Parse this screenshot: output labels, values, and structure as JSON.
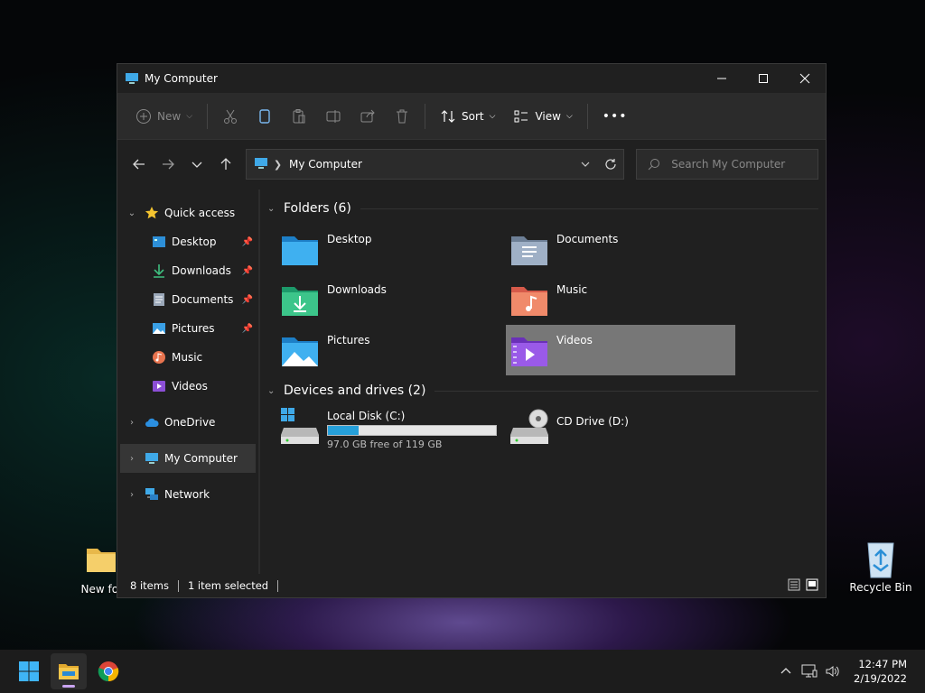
{
  "desktop": {
    "new_folder_label": "New fol",
    "recycle_bin_label": "Recycle Bin"
  },
  "window": {
    "title": "My Computer",
    "controls": {
      "minimize": "minimize",
      "maximize": "maximize",
      "close": "close"
    }
  },
  "toolbar": {
    "new_label": "New",
    "sort_label": "Sort",
    "view_label": "View",
    "more_label": "•••"
  },
  "navbar": {
    "address_text": "My Computer",
    "search_placeholder": "Search My Computer"
  },
  "sidebar": {
    "quick_access": "Quick access",
    "items": [
      {
        "label": "Desktop",
        "pinned": true
      },
      {
        "label": "Downloads",
        "pinned": true
      },
      {
        "label": "Documents",
        "pinned": true
      },
      {
        "label": "Pictures",
        "pinned": true
      },
      {
        "label": "Music",
        "pinned": false
      },
      {
        "label": "Videos",
        "pinned": false
      }
    ],
    "onedrive": "OneDrive",
    "my_computer": "My Computer",
    "network": "Network"
  },
  "main": {
    "folders_header": "Folders (6)",
    "folders": [
      {
        "name": "Desktop",
        "icon": "desktop-folder-icon"
      },
      {
        "name": "Documents",
        "icon": "documents-folder-icon"
      },
      {
        "name": "Downloads",
        "icon": "downloads-folder-icon"
      },
      {
        "name": "Music",
        "icon": "music-folder-icon"
      },
      {
        "name": "Pictures",
        "icon": "pictures-folder-icon"
      },
      {
        "name": "Videos",
        "icon": "videos-folder-icon",
        "selected": true
      }
    ],
    "devices_header": "Devices and drives (2)",
    "drives": [
      {
        "name": "Local Disk (C:)",
        "free_text": "97.0 GB free of 119 GB",
        "used_fraction": 0.185
      },
      {
        "name": "CD Drive (D:)"
      }
    ]
  },
  "status": {
    "items": "8 items",
    "selected": "1 item selected"
  },
  "taskbar": {
    "time": "12:47 PM",
    "date": "2/19/2022"
  },
  "colors": {
    "accent": "#26a0da",
    "window_bg": "#202020",
    "toolbar_bg": "#2b2b2b",
    "selected_tile": "#777777"
  }
}
